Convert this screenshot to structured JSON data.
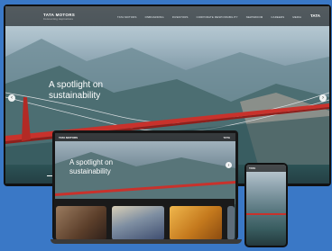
{
  "header": {
    "logo_text": "TATA MOTORS",
    "logo_tagline": "Connecting Aspirations",
    "brand_mark": "TATA",
    "nav_items": [
      "TATA MOTORS",
      "ONBOARDING",
      "INVESTORS",
      "CORPORATE RESPONSIBILITY",
      "NEWSROOM",
      "CAREERS",
      "MEDIA"
    ]
  },
  "hero": {
    "title": "A spotlight on sustainability"
  },
  "colors": {
    "background": "#3a78c6",
    "bridge": "#c8322c"
  }
}
